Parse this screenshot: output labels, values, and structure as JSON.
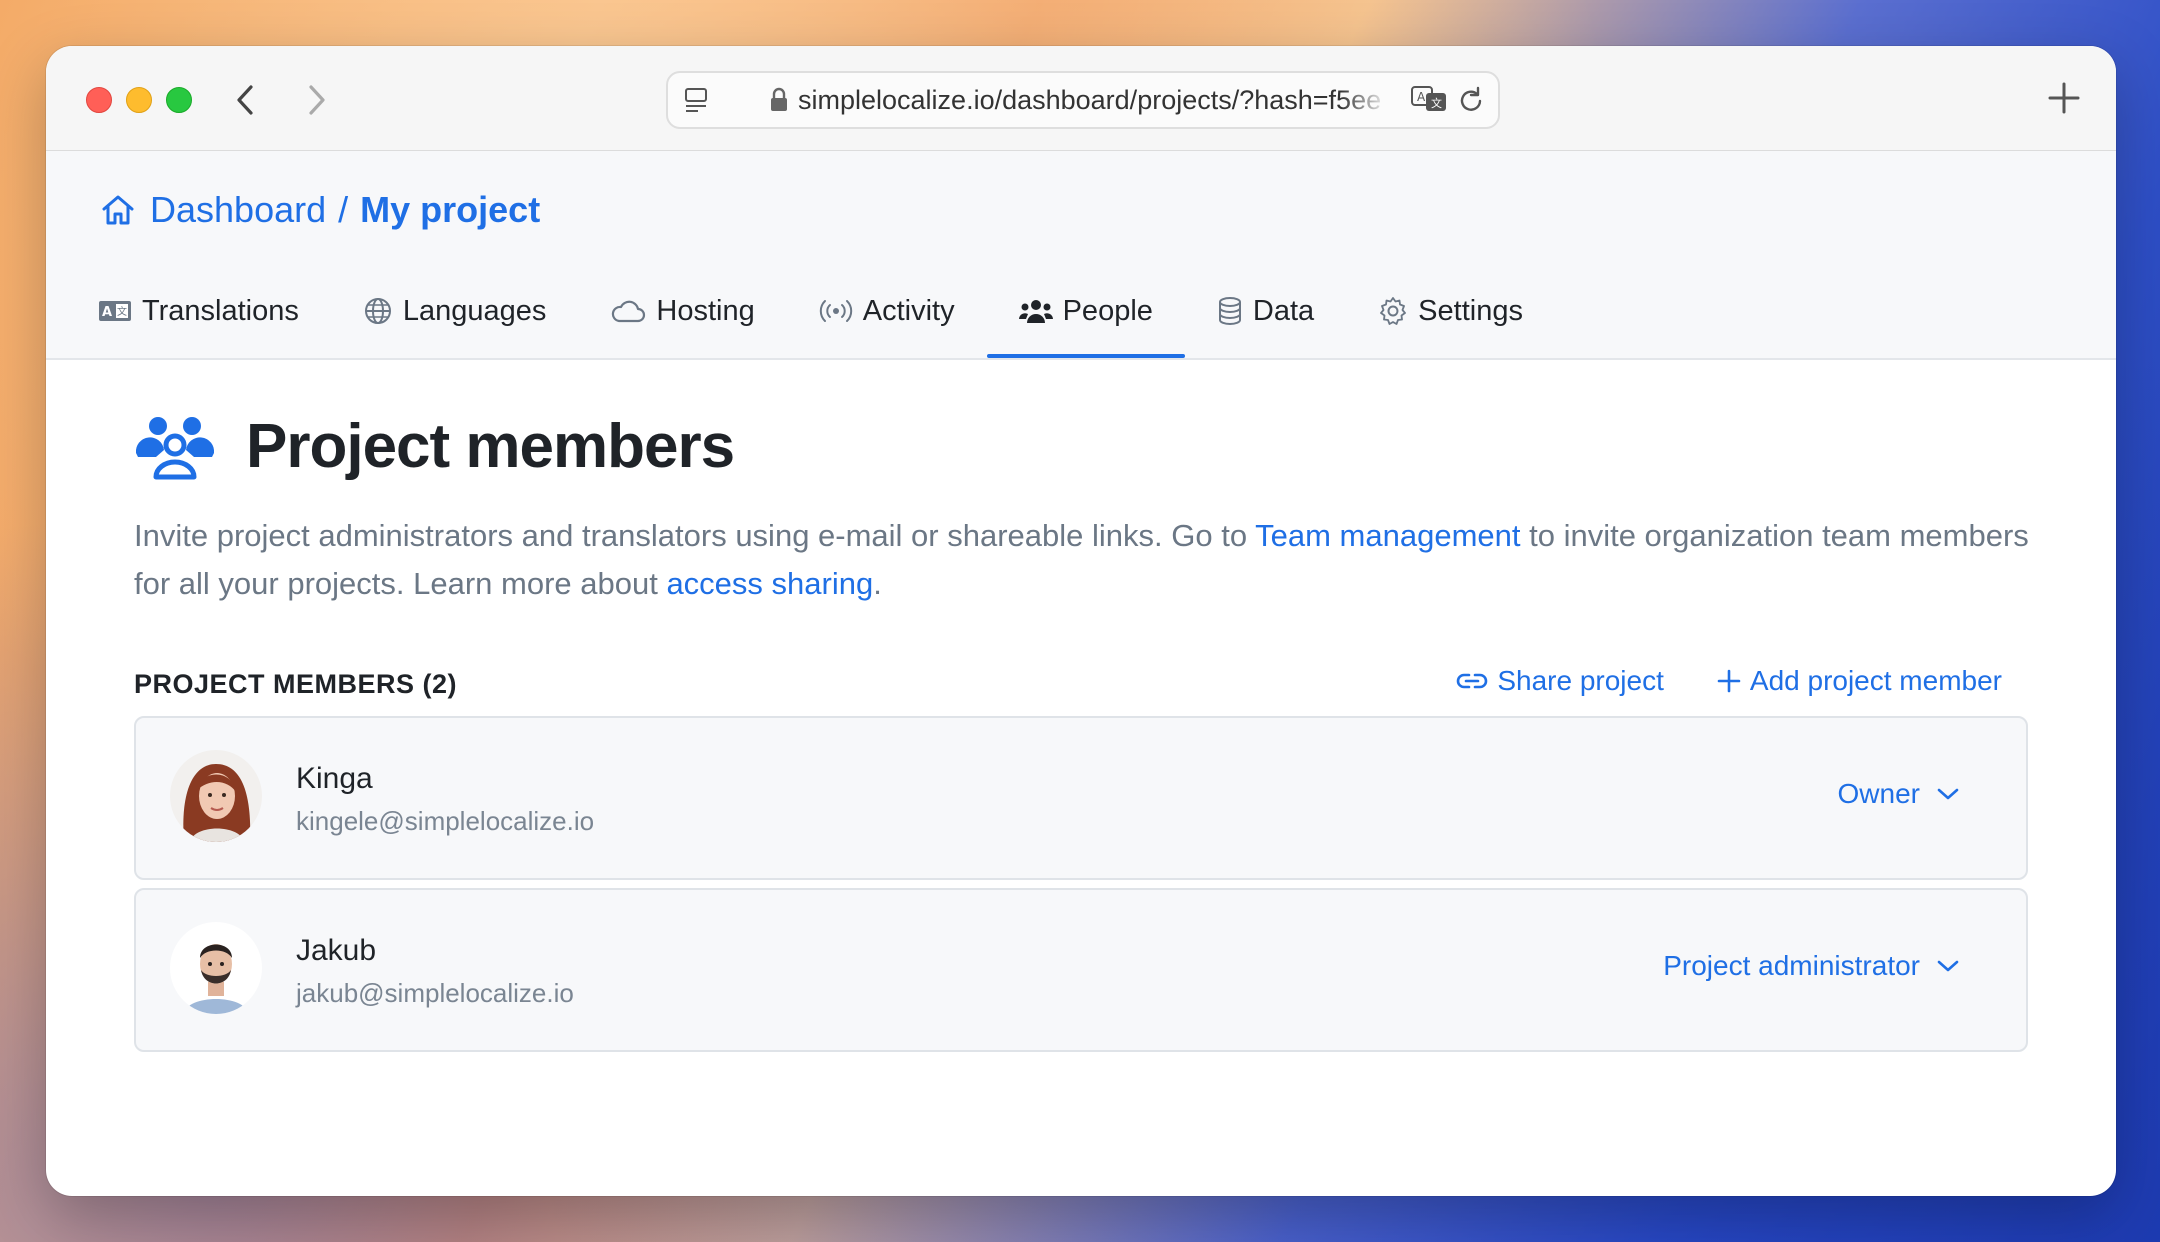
{
  "browser": {
    "url": "simplelocalize.io/dashboard/projects/?hash=f5ee"
  },
  "breadcrumb": {
    "home_label": "Dashboard",
    "separator": "/",
    "current": "My project"
  },
  "tabs": [
    {
      "label": "Translations",
      "icon": "translation-icon"
    },
    {
      "label": "Languages",
      "icon": "globe-icon"
    },
    {
      "label": "Hosting",
      "icon": "cloud-icon"
    },
    {
      "label": "Activity",
      "icon": "broadcast-icon"
    },
    {
      "label": "People",
      "icon": "people-icon",
      "active": true
    },
    {
      "label": "Data",
      "icon": "database-icon"
    },
    {
      "label": "Settings",
      "icon": "gear-icon"
    }
  ],
  "page": {
    "title": "Project members",
    "desc_part1": "Invite project administrators and translators using e-mail or shareable links. Go to ",
    "desc_link1": "Team management",
    "desc_part2": " to invite organization team members for all your projects. Learn more about ",
    "desc_link2": "access sharing",
    "desc_part3": "."
  },
  "members_section": {
    "title": "PROJECT MEMBERS (2)",
    "share_label": "Share project",
    "add_label": "Add project member"
  },
  "members": [
    {
      "name": "Kinga",
      "email": "kingele@simplelocalize.io",
      "role": "Owner"
    },
    {
      "name": "Jakub",
      "email": "jakub@simplelocalize.io",
      "role": "Project administrator"
    }
  ],
  "colors": {
    "accent": "#1f6fe5",
    "text": "#1f2328",
    "muted": "#6b7785"
  }
}
